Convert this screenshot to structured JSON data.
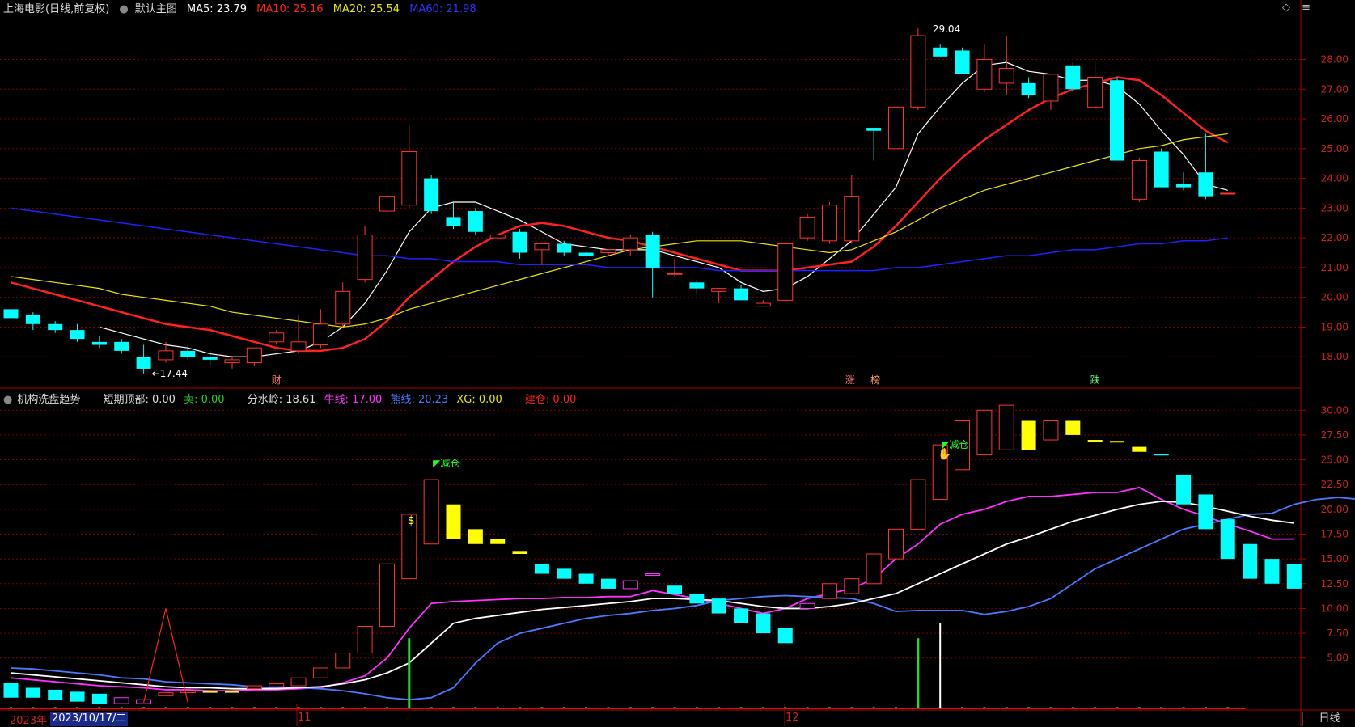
{
  "header": {
    "title": "上海电影(日线,前复权)",
    "theme_label": "默认主图",
    "ma5": "MA5: 23.79",
    "ma10": "MA10: 25.16",
    "ma20": "MA20: 25.54",
    "ma60": "MA60: 21.98"
  },
  "sub_header": {
    "name": "机构洗盘趋势",
    "short_top": "短期顶部: 0.00",
    "sell": "卖: 0.00",
    "water": "分水岭: 18.61",
    "bull": "牛线: 17.00",
    "bear": "熊线: 20.23",
    "xg": "XG: 0.00",
    "build": "建仓: 0.00"
  },
  "annotations": {
    "high": "29.04",
    "low": "17.44",
    "cai": "财",
    "zhang": "涨",
    "bang": "榜",
    "die": "跌",
    "reduce1": "减仓",
    "reduce2": "减仓"
  },
  "bottom": {
    "year": "2023年",
    "date": "2023/10/17/二",
    "m11": "11",
    "m12": "12",
    "period": "日线"
  },
  "colors": {
    "up": "#ff3232",
    "down": "#00ffff",
    "ma5": "#ffffff",
    "ma10": "#ff2020",
    "ma20": "#e8e800",
    "ma60": "#2020ff",
    "grid": "#7a0000"
  },
  "chart_data": [
    {
      "type": "candlestick",
      "title": "上海电影(日线,前复权)",
      "ylim": [
        17.0,
        29.4
      ],
      "y_ticks": [
        18.0,
        19.0,
        20.0,
        21.0,
        22.0,
        23.0,
        24.0,
        25.0,
        26.0,
        27.0,
        28.0
      ],
      "x_ticks": [
        "11",
        "12"
      ],
      "candles": [
        [
          19.6,
          19.6,
          19.3,
          19.3
        ],
        [
          19.4,
          19.5,
          18.9,
          19.1
        ],
        [
          19.1,
          19.2,
          18.8,
          18.9
        ],
        [
          18.9,
          19.1,
          18.5,
          18.6
        ],
        [
          18.5,
          18.7,
          18.3,
          18.4
        ],
        [
          18.5,
          18.6,
          18.1,
          18.2
        ],
        [
          18.0,
          18.4,
          17.44,
          17.6
        ],
        [
          17.9,
          18.5,
          17.8,
          18.2
        ],
        [
          18.2,
          18.4,
          17.9,
          18.0
        ],
        [
          18.0,
          18.2,
          17.7,
          17.9
        ],
        [
          17.8,
          18.0,
          17.6,
          17.9
        ],
        [
          17.8,
          18.3,
          17.7,
          18.3
        ],
        [
          18.5,
          18.9,
          18.4,
          18.8
        ],
        [
          18.2,
          19.4,
          18.1,
          18.5
        ],
        [
          18.4,
          19.6,
          18.3,
          19.1
        ],
        [
          19.1,
          20.5,
          19.0,
          20.2
        ],
        [
          20.6,
          22.4,
          20.5,
          22.1
        ],
        [
          22.9,
          23.9,
          22.7,
          23.4
        ],
        [
          23.1,
          25.8,
          23.0,
          24.9
        ],
        [
          24.0,
          24.1,
          22.8,
          22.9
        ],
        [
          22.7,
          23.2,
          22.3,
          22.4
        ],
        [
          22.9,
          23.0,
          22.1,
          22.2
        ],
        [
          22.0,
          22.1,
          21.9,
          22.1
        ],
        [
          22.2,
          22.3,
          21.3,
          21.5
        ],
        [
          21.6,
          21.8,
          21.1,
          21.8
        ],
        [
          21.8,
          21.9,
          21.4,
          21.5
        ],
        [
          21.5,
          21.6,
          21.3,
          21.4
        ],
        [
          21.5,
          21.6,
          21.4,
          21.6
        ],
        [
          21.6,
          22.1,
          21.4,
          22.0
        ],
        [
          22.1,
          22.2,
          20.0,
          21.0
        ],
        [
          20.8,
          21.3,
          20.7,
          20.8
        ],
        [
          20.5,
          20.6,
          20.1,
          20.3
        ],
        [
          20.2,
          20.3,
          19.8,
          20.3
        ],
        [
          20.3,
          20.4,
          19.9,
          19.9
        ],
        [
          19.7,
          19.9,
          19.7,
          19.8
        ],
        [
          19.9,
          21.8,
          19.9,
          21.8
        ],
        [
          22.0,
          22.8,
          21.9,
          22.7
        ],
        [
          21.9,
          23.2,
          21.8,
          23.1
        ],
        [
          21.9,
          24.1,
          21.8,
          23.4
        ],
        [
          25.7,
          25.7,
          24.6,
          25.6
        ],
        [
          25.0,
          26.8,
          25.0,
          26.4
        ],
        [
          26.4,
          29.04,
          26.3,
          28.8
        ],
        [
          28.4,
          28.5,
          28.1,
          28.1
        ],
        [
          28.3,
          28.4,
          27.5,
          27.5
        ],
        [
          27.0,
          28.5,
          26.9,
          28.0
        ],
        [
          27.2,
          28.8,
          26.8,
          27.7
        ],
        [
          27.2,
          27.4,
          26.7,
          26.8
        ],
        [
          26.6,
          27.5,
          26.3,
          27.5
        ],
        [
          27.8,
          27.9,
          26.9,
          27.0
        ],
        [
          26.4,
          27.9,
          26.3,
          27.4
        ],
        [
          27.3,
          27.4,
          24.6,
          24.6
        ],
        [
          23.3,
          24.7,
          23.2,
          24.6
        ],
        [
          24.9,
          25.0,
          23.7,
          23.7
        ],
        [
          23.8,
          24.2,
          23.6,
          23.7
        ],
        [
          24.2,
          25.5,
          23.3,
          23.4
        ],
        [
          23.5,
          23.5,
          23.5,
          23.5
        ]
      ],
      "series": [
        {
          "name": "MA5",
          "values": [
            null,
            null,
            null,
            null,
            19.0,
            18.8,
            18.6,
            18.4,
            18.3,
            18.1,
            18.0,
            18.0,
            18.1,
            18.2,
            18.5,
            19.0,
            19.8,
            20.9,
            22.2,
            23.0,
            23.2,
            23.2,
            22.9,
            22.6,
            22.2,
            21.8,
            21.7,
            21.6,
            21.6,
            21.6,
            21.4,
            21.2,
            21.0,
            20.5,
            20.2,
            20.3,
            20.7,
            21.3,
            21.9,
            22.8,
            23.7,
            25.5,
            26.4,
            27.2,
            27.8,
            27.9,
            27.6,
            27.5,
            27.3,
            27.3,
            27.1,
            26.5,
            25.6,
            24.8,
            23.8,
            23.6
          ]
        },
        {
          "name": "MA10",
          "values": [
            20.5,
            20.3,
            20.1,
            19.9,
            19.7,
            19.5,
            19.3,
            19.1,
            19.0,
            18.9,
            18.7,
            18.5,
            18.3,
            18.2,
            18.2,
            18.3,
            18.6,
            19.2,
            20.0,
            20.6,
            21.2,
            21.7,
            22.1,
            22.4,
            22.5,
            22.4,
            22.2,
            22.0,
            21.9,
            21.7,
            21.5,
            21.3,
            21.1,
            20.9,
            20.9,
            20.9,
            21.0,
            21.1,
            21.2,
            21.7,
            22.4,
            23.2,
            24.0,
            24.7,
            25.3,
            25.8,
            26.3,
            26.7,
            27.0,
            27.2,
            27.4,
            27.3,
            26.8,
            26.2,
            25.6,
            25.2
          ]
        },
        {
          "name": "MA20",
          "values": [
            20.7,
            20.6,
            20.5,
            20.4,
            20.3,
            20.1,
            20.0,
            19.9,
            19.8,
            19.7,
            19.5,
            19.4,
            19.3,
            19.2,
            19.1,
            19.0,
            19.1,
            19.3,
            19.6,
            19.8,
            20.0,
            20.2,
            20.4,
            20.6,
            20.8,
            21.0,
            21.2,
            21.4,
            21.6,
            21.7,
            21.8,
            21.9,
            21.9,
            21.9,
            21.8,
            21.7,
            21.6,
            21.5,
            21.6,
            21.9,
            22.2,
            22.6,
            23.0,
            23.3,
            23.6,
            23.8,
            24.0,
            24.2,
            24.4,
            24.6,
            24.8,
            25.0,
            25.1,
            25.3,
            25.4,
            25.5
          ]
        },
        {
          "name": "MA60",
          "values": [
            23.0,
            22.9,
            22.8,
            22.7,
            22.6,
            22.5,
            22.4,
            22.3,
            22.2,
            22.1,
            22.0,
            21.9,
            21.8,
            21.7,
            21.6,
            21.5,
            21.4,
            21.4,
            21.3,
            21.3,
            21.2,
            21.2,
            21.2,
            21.1,
            21.1,
            21.1,
            21.1,
            21.0,
            21.0,
            21.0,
            21.0,
            21.0,
            20.9,
            20.9,
            20.9,
            20.9,
            20.9,
            20.9,
            20.9,
            20.9,
            21.0,
            21.0,
            21.1,
            21.2,
            21.3,
            21.4,
            21.4,
            21.5,
            21.6,
            21.6,
            21.7,
            21.8,
            21.8,
            21.9,
            21.9,
            22.0
          ]
        }
      ]
    },
    {
      "type": "indicator",
      "title": "机构洗盘趋势",
      "ylim": [
        0,
        31
      ],
      "y_ticks": [
        5.0,
        7.5,
        10.0,
        12.5,
        15.0,
        17.5,
        20.0,
        22.5,
        25.0,
        27.5,
        30.0
      ],
      "bars": [
        [
          1.0,
          2.5,
          "c"
        ],
        [
          1.0,
          2.0,
          "c"
        ],
        [
          0.8,
          1.8,
          "c"
        ],
        [
          0.6,
          1.6,
          "c"
        ],
        [
          0.4,
          1.4,
          "c"
        ],
        [
          0.4,
          1.0,
          "m"
        ],
        [
          0.4,
          0.8,
          "m"
        ],
        [
          1.2,
          1.5,
          "r"
        ],
        [
          1.5,
          1.7,
          "r"
        ],
        [
          1.5,
          1.7,
          "y"
        ],
        [
          1.5,
          1.7,
          "y"
        ],
        [
          1.9,
          2.2,
          "r"
        ],
        [
          2.1,
          2.4,
          "r"
        ],
        [
          2.2,
          3.0,
          "r"
        ],
        [
          3.0,
          4.0,
          "r"
        ],
        [
          4.0,
          5.5,
          "r"
        ],
        [
          5.5,
          8.2,
          "r"
        ],
        [
          8.2,
          14.5,
          "r"
        ],
        [
          13.0,
          19.5,
          "r"
        ],
        [
          16.5,
          23.0,
          "r"
        ],
        [
          17.0,
          20.5,
          "y"
        ],
        [
          16.5,
          18.0,
          "y"
        ],
        [
          16.5,
          17.0,
          "y"
        ],
        [
          15.5,
          15.8,
          "y"
        ],
        [
          13.5,
          14.5,
          "c"
        ],
        [
          13.0,
          14.0,
          "c"
        ],
        [
          12.5,
          13.5,
          "c"
        ],
        [
          12.0,
          13.0,
          "c"
        ],
        [
          12.0,
          12.8,
          "m"
        ],
        [
          13.4,
          13.5,
          "m"
        ],
        [
          11.5,
          12.3,
          "c"
        ],
        [
          10.5,
          11.5,
          "c"
        ],
        [
          9.5,
          11.0,
          "c"
        ],
        [
          8.5,
          10.0,
          "c"
        ],
        [
          7.5,
          9.5,
          "c"
        ],
        [
          6.5,
          8.0,
          "c"
        ],
        [
          10.0,
          10.5,
          "m"
        ],
        [
          11.0,
          12.5,
          "r"
        ],
        [
          11.5,
          13.0,
          "r"
        ],
        [
          12.5,
          15.5,
          "r"
        ],
        [
          15.0,
          18.0,
          "r"
        ],
        [
          18.0,
          23.0,
          "r"
        ],
        [
          21.0,
          26.5,
          "r"
        ],
        [
          24.0,
          29.0,
          "r"
        ],
        [
          25.5,
          30.0,
          "r"
        ],
        [
          26.0,
          30.5,
          "r"
        ],
        [
          26.0,
          29.0,
          "y"
        ],
        [
          27.0,
          29.0,
          "r"
        ],
        [
          27.5,
          29.0,
          "y"
        ],
        [
          26.8,
          27.0,
          "y"
        ],
        [
          26.8,
          26.9,
          "y"
        ],
        [
          25.8,
          26.3,
          "y"
        ],
        [
          25.5,
          25.6,
          "c"
        ],
        [
          20.5,
          23.5,
          "c"
        ],
        [
          18.0,
          21.5,
          "c"
        ],
        [
          15.0,
          19.0,
          "c"
        ],
        [
          13.0,
          16.5,
          "c"
        ],
        [
          12.5,
          15.0,
          "c"
        ],
        [
          12.0,
          14.5,
          "c"
        ]
      ],
      "series": [
        {
          "name": "牛线",
          "values": [
            3.0,
            2.8,
            2.6,
            2.4,
            2.2,
            2.1,
            2.0,
            1.8,
            1.8,
            1.7,
            1.7,
            1.8,
            1.8,
            1.9,
            2.0,
            2.5,
            3.2,
            5.0,
            8.0,
            10.5,
            10.7,
            10.8,
            10.9,
            11.0,
            11.0,
            11.1,
            11.1,
            11.2,
            11.2,
            11.8,
            11.4,
            11.0,
            10.5,
            10.0,
            9.5,
            10.0,
            11.0,
            11.5,
            12.0,
            13.0,
            15.0,
            16.5,
            18.5,
            19.5,
            20.0,
            20.8,
            21.3,
            21.3,
            21.5,
            21.7,
            21.7,
            22.2,
            21.0,
            20.0,
            19.3,
            18.5,
            17.8,
            17.0,
            17.0
          ]
        },
        {
          "name": "熊线",
          "values": [
            4.0,
            3.9,
            3.7,
            3.5,
            3.3,
            3.0,
            2.9,
            2.6,
            2.5,
            2.4,
            2.3,
            2.1,
            2.0,
            2.0,
            1.9,
            1.7,
            1.4,
            1.0,
            0.8,
            1.0,
            2.0,
            4.5,
            6.5,
            7.5,
            8.0,
            8.5,
            9.0,
            9.3,
            9.5,
            9.8,
            10.0,
            10.3,
            10.8,
            11.0,
            11.2,
            11.3,
            11.2,
            11.1,
            11.0,
            10.5,
            9.7,
            9.8,
            9.8,
            9.8,
            9.4,
            9.7,
            10.2,
            11.0,
            12.5,
            14.0,
            15.0,
            16.0,
            17.0,
            18.0,
            18.5,
            19.0,
            19.5,
            19.6,
            20.5,
            21.0,
            21.2,
            21.0,
            20.5,
            20.0
          ]
        },
        {
          "name": "分水岭",
          "values": [
            3.5,
            3.3,
            3.1,
            2.9,
            2.7,
            2.5,
            2.3,
            2.1,
            2.0,
            2.0,
            1.9,
            1.9,
            1.9,
            2.0,
            2.1,
            2.4,
            2.8,
            3.5,
            4.5,
            6.5,
            8.5,
            9.0,
            9.3,
            9.6,
            9.9,
            10.1,
            10.3,
            10.5,
            10.7,
            11.0,
            11.0,
            10.9,
            10.8,
            10.5,
            10.2,
            10.0,
            10.0,
            10.2,
            10.5,
            11.0,
            11.5,
            12.5,
            13.5,
            14.5,
            15.5,
            16.5,
            17.2,
            18.0,
            18.8,
            19.4,
            20.0,
            20.5,
            20.8,
            20.7,
            20.3,
            19.8,
            19.3,
            18.9,
            18.61
          ]
        }
      ]
    }
  ]
}
